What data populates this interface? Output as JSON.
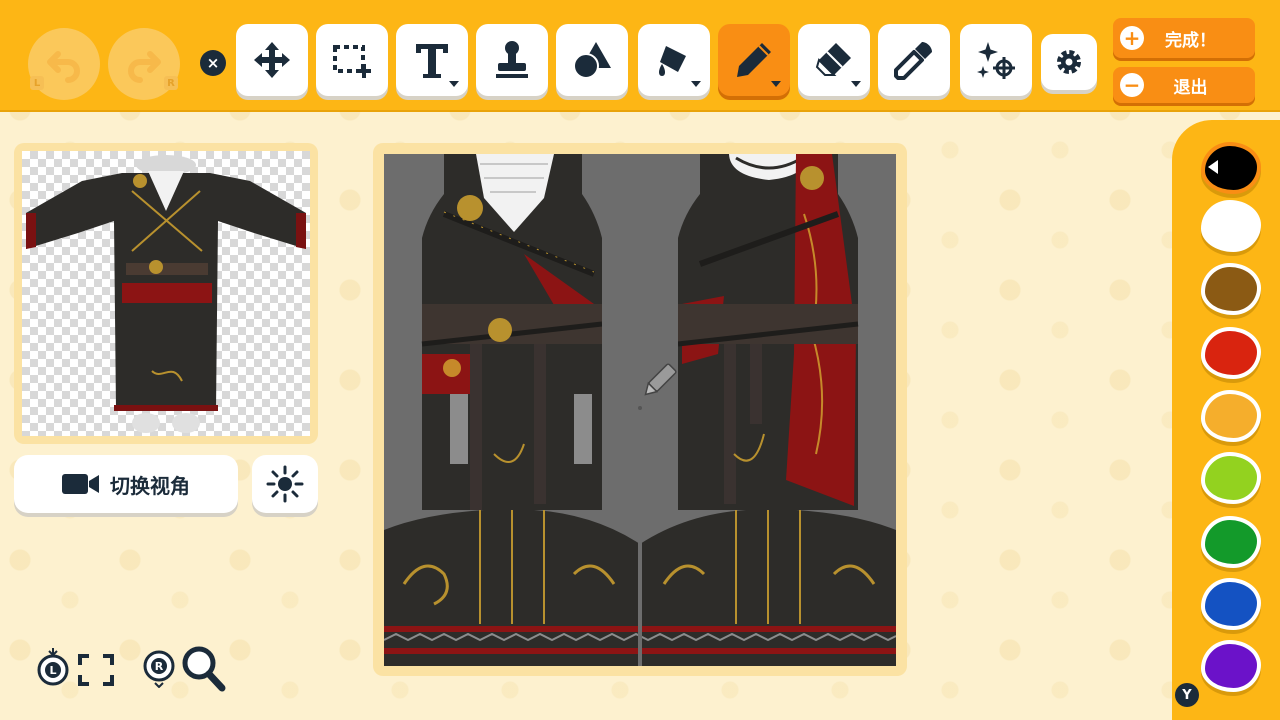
{
  "toolbar": {
    "undo_trigger": "L",
    "redo_trigger": "R",
    "close_symbol": "×",
    "tools": [
      {
        "name": "move",
        "icon": "move-arrows-icon"
      },
      {
        "name": "select",
        "icon": "marquee-select-icon"
      },
      {
        "name": "text",
        "icon": "text-T-icon"
      },
      {
        "name": "stamp",
        "icon": "stamp-icon"
      },
      {
        "name": "shapes",
        "icon": "shapes-icon"
      },
      {
        "name": "fill",
        "icon": "paint-bucket-icon"
      },
      {
        "name": "pencil",
        "icon": "pencil-icon",
        "active": true
      },
      {
        "name": "eraser",
        "icon": "eraser-icon"
      },
      {
        "name": "eyedropper",
        "icon": "eyedropper-icon"
      },
      {
        "name": "effects",
        "icon": "sparkle-target-icon"
      },
      {
        "name": "settings",
        "icon": "gear-icon"
      }
    ],
    "done_symbol": "+",
    "done_label": "完成！",
    "exit_symbol": "−",
    "exit_label": "退出"
  },
  "left_panel": {
    "switch_view_label": "切换视角",
    "camera_icon": "camera-icon",
    "lighting_icon": "sun-icon"
  },
  "bottom_controls": {
    "trigger_L": "L",
    "trigger_R": "R",
    "icons": [
      "stick-L-icon",
      "fullscreen-icon",
      "stick-R-icon",
      "magnifier-icon"
    ]
  },
  "palette": {
    "colors": [
      "#000000",
      "#ffffff",
      "#8b5a14",
      "#d9240f",
      "#f5ae2c",
      "#93d21f",
      "#139a2a",
      "#1452c2",
      "#6b12c9"
    ],
    "selected_index": 0,
    "page_button": "Y"
  },
  "canvas": {
    "garment_colors": {
      "base": "#2d2c29",
      "background": "#6d6d6d",
      "red": "#8c1414",
      "gold": "#b8912e",
      "collar": "#f2f2f2"
    }
  }
}
